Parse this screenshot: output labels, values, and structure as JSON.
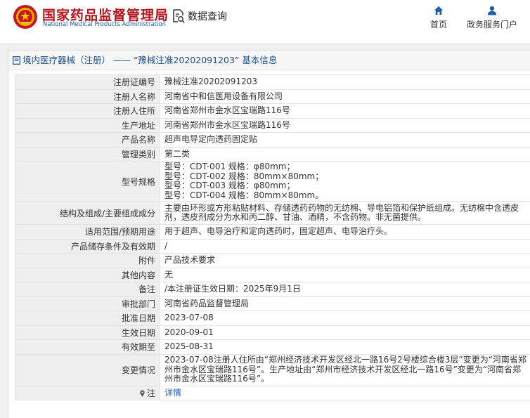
{
  "header": {
    "site_title": "国家药品监督管理局",
    "site_subtitle": "National Medical Products Administration",
    "query_label": "数据查询",
    "nav": [
      {
        "label": "首页",
        "icon": "home-icon"
      },
      {
        "label": "政务服务门户",
        "icon": "user-icon"
      }
    ]
  },
  "panel": {
    "title": "境内医疗器械（注册） —— “豫械注准20202091203” 基本信息"
  },
  "rows": [
    {
      "label": "注册证编号",
      "value": "豫械注准20202091203"
    },
    {
      "label": "注册人名称",
      "value": "河南省中和信医用设备有限公司"
    },
    {
      "label": "注册人住所",
      "value": "河南省郑州市金水区宝瑞路116号"
    },
    {
      "label": "生产地址",
      "value": "河南省郑州市金水区宝瑞路116号"
    },
    {
      "label": "产品名称",
      "value": "超声电导定向透药固定贴"
    },
    {
      "label": "管理类别",
      "value": "第二类"
    },
    {
      "label": "型号规格",
      "lines": [
        "型号：CDT-001 规格：φ80mm；",
        "型号：CDT-002 规格：80mm×80mm；",
        "型号：CDT-003 规格：φ80mm；",
        "型号：CDT-004 规格：80mm×80mm。"
      ]
    },
    {
      "label": "结构及组成/主要组成成分",
      "value": "主要由环形或方形粘贴材料、存储透药药物的无纺棉、导电铝箔和保护纸组成。无纺棉中含透皮剂，透皮剂成分为水和丙二醇、甘油、酒精，不含药物。非无菌提供。"
    },
    {
      "label": "适用范围/预期用途",
      "value": "用于超声、电导治疗和定向透药时，固定超声、电导治疗头。"
    },
    {
      "label": "产品储存条件及有效期",
      "value": "/"
    },
    {
      "label": "附件",
      "value": "产品技术要求"
    },
    {
      "label": "其他内容",
      "value": "无"
    },
    {
      "label": "备注",
      "value": "/本注册证生效日期：2025年9月1日"
    },
    {
      "label": "审批部门",
      "value": "河南省药品监督管理局"
    },
    {
      "label": "批准日期",
      "value": "2023-07-08"
    },
    {
      "label": "生效日期",
      "value": "2020-09-01"
    },
    {
      "label": "有效期至",
      "value": "2025-08-31"
    },
    {
      "label": "变更情况",
      "value": "2023-07-08注册人住所由“郑州经济技术开发区经北一路16号2号楼综合楼3层”变更为“河南省郑州市金水区宝瑞路116号”。生产地址由“郑州市经济技术开发区经北一路16号”变更为“河南省郑州市金水区宝瑞路116号”。"
    },
    {
      "label": "注",
      "value": "详情"
    }
  ],
  "colors": {
    "brand_red": "#b7141b",
    "link_blue": "#1d62b5",
    "nav_blue": "#1d5fa8"
  }
}
